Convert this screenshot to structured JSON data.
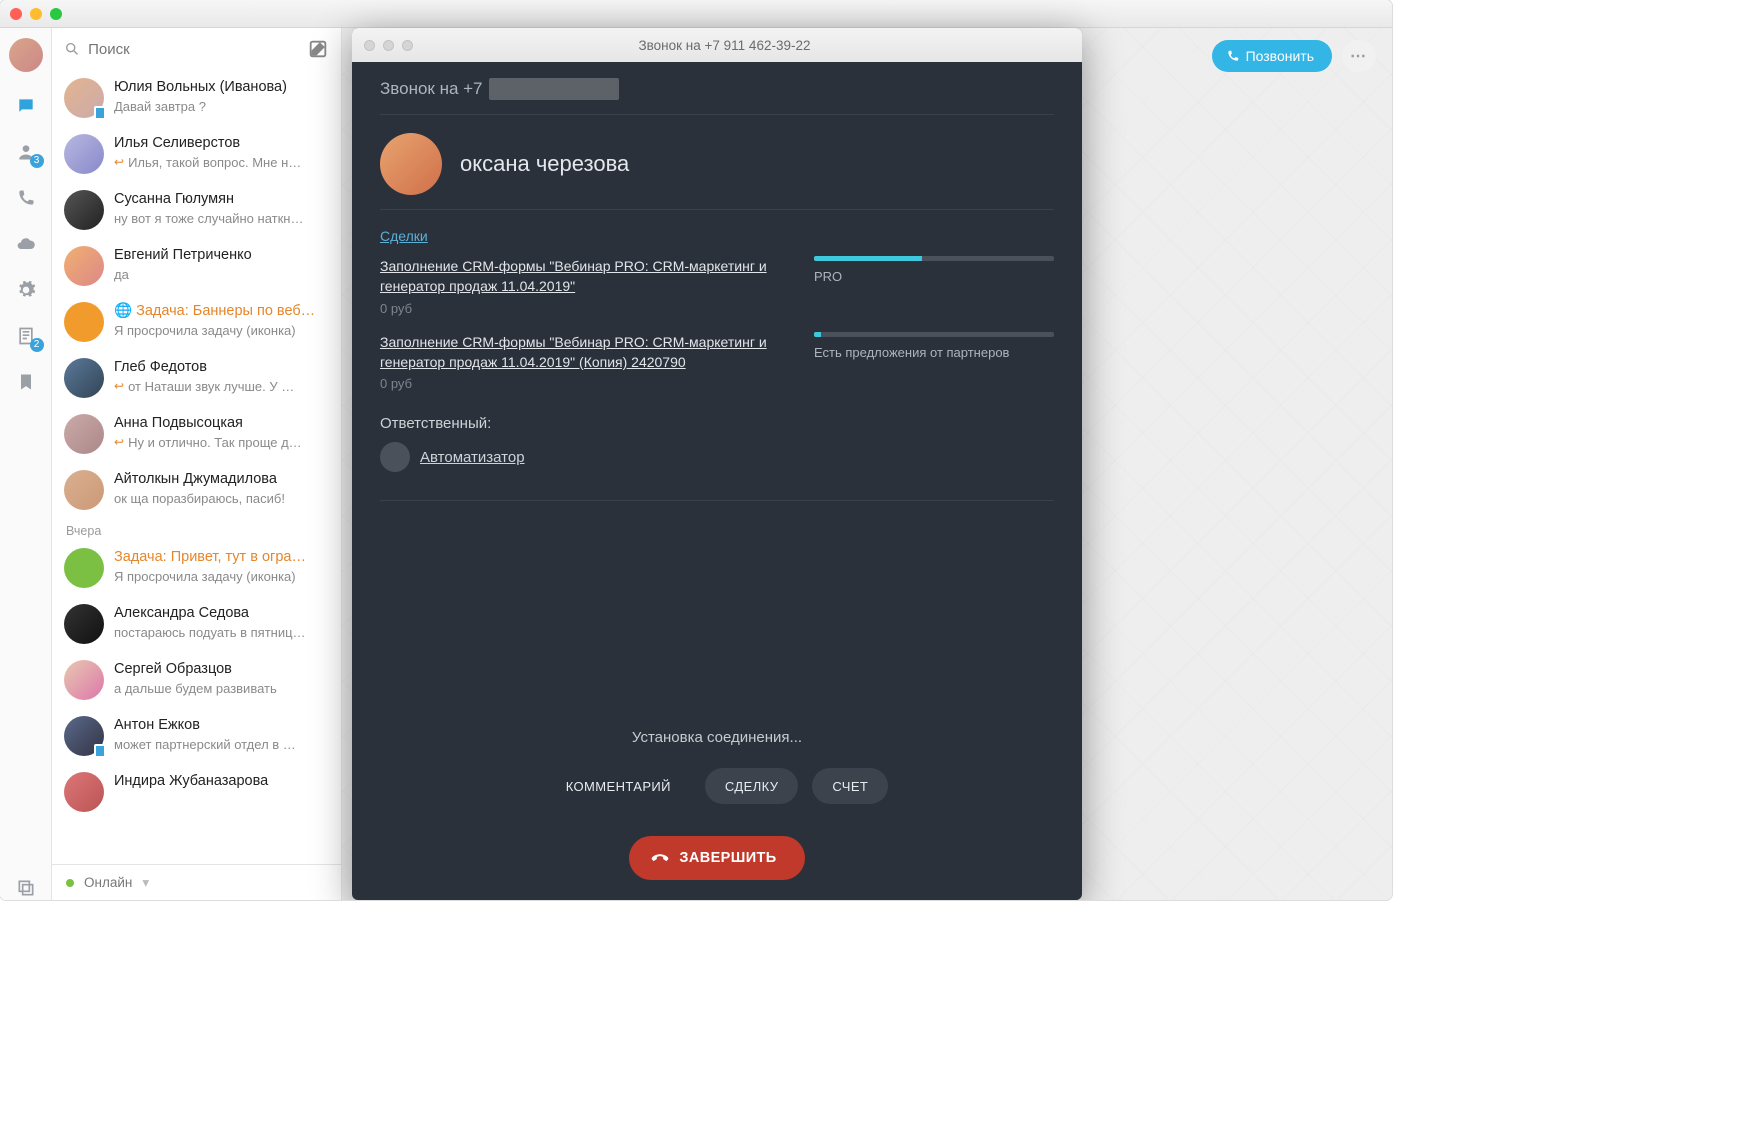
{
  "search": {
    "placeholder": "Поиск"
  },
  "rail": {
    "badges": {
      "contacts": "3",
      "notes": "2"
    }
  },
  "chats": [
    {
      "name": "Юлия Вольных (Иванова)",
      "preview": "Давай завтра ?",
      "mobile": true,
      "avatarClass": "c1"
    },
    {
      "name": "Илья Селиверстов",
      "preview": "Илья, такой вопрос. Мне н…",
      "reply": true,
      "avatarClass": "c2"
    },
    {
      "name": "Сусанна Гюлумян",
      "preview": "ну вот я тоже случайно наткн…",
      "avatarClass": "c3"
    },
    {
      "name": "Евгений Петриченко",
      "preview": "да",
      "avatarClass": "c4"
    },
    {
      "name": "Задача: Баннеры по веб…",
      "preview": "Я просрочила задачу (иконка)",
      "task": true,
      "avatarClass": "c5",
      "globe": true
    },
    {
      "name": "Глеб Федотов",
      "preview": "от Наташи звук лучше. У …",
      "reply": true,
      "avatarClass": "c6"
    },
    {
      "name": "Анна Подвысоцкая",
      "preview": "Ну и отлично. Так проще д…",
      "reply": true,
      "avatarClass": "c7"
    },
    {
      "name": "Айтолкын Джумадилова",
      "preview": "ок ща поразбираюсь, пасиб!",
      "avatarClass": "c8"
    }
  ],
  "sectionLabel": "Вчера",
  "chats2": [
    {
      "name": "Задача: Привет, тут в огра…",
      "preview": "Я просрочила задачу (иконка)",
      "task": true,
      "avatarClass": "c9"
    },
    {
      "name": "Александра Седова",
      "preview": "постараюсь подуать в пятниц…",
      "avatarClass": "c10"
    },
    {
      "name": "Сергей Образцов",
      "preview": "а дальше будем развивать",
      "avatarClass": "c11"
    },
    {
      "name": "Антон Ежков",
      "preview": "может партнерский отдел в …",
      "mobile": true,
      "avatarClass": "c12"
    },
    {
      "name": "Индира Жубаназарова",
      "preview": "",
      "avatarClass": "c13"
    }
  ],
  "status": {
    "label": "Онлайн"
  },
  "topbar": {
    "call": "Позвонить"
  },
  "call": {
    "windowTitle": "Звонок на +7 911 462-39-22",
    "heading": "Звонок на +7",
    "contactName": "оксана черезова",
    "dealsLabel": "Сделки",
    "deals": [
      {
        "title": "Заполнение CRM-формы \"Вебинар PRO: CRM-маркетинг и генератор продаж 11.04.2019\"",
        "price": "0 руб",
        "stage": "PRO",
        "progress": 45
      },
      {
        "title": "Заполнение CRM-формы \"Вебинар PRO: CRM-маркетинг и генератор продаж 11.04.2019\" (Копия) 2420790",
        "price": "0 руб",
        "stage": "Есть предложения от партнеров",
        "progress": 3
      }
    ],
    "responsibleLabel": "Ответственный:",
    "responsibleName": "Автоматизатор",
    "connecting": "Установка соединения...",
    "actions": {
      "comment": "КОММЕНТАРИЙ",
      "deal": "СДЕЛКУ",
      "invoice": "СЧЕТ"
    },
    "endLabel": "ЗАВЕРШИТЬ"
  }
}
